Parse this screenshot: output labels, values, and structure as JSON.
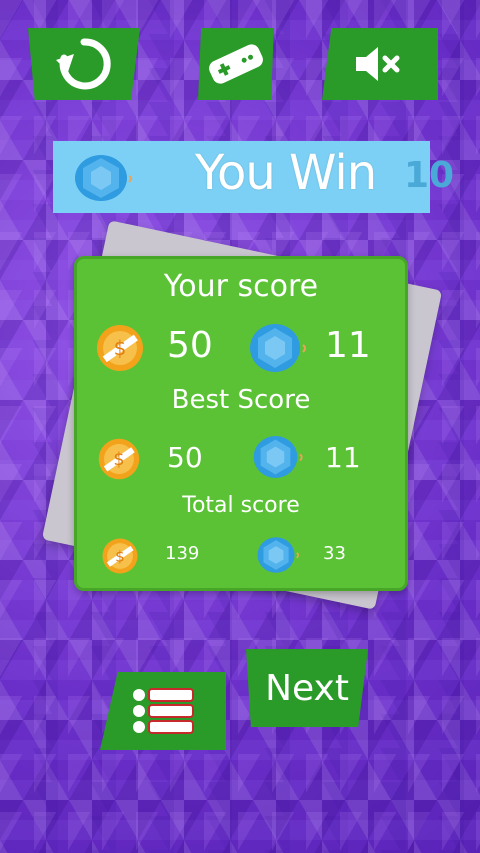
{
  "header": {
    "title": "You Win",
    "level": "10"
  },
  "toolbar": {
    "restart_icon": "restart-icon",
    "games_icon": "gamepad-icon",
    "mute_icon": "sound-muted-icon"
  },
  "scores": {
    "your_score_label": "Your score",
    "your_coins": "50",
    "your_gems": "11",
    "best_score_label": "Best Score",
    "best_coins": "50",
    "best_gems": "11",
    "total_score_label": "Total score",
    "total_coins": "139",
    "total_gems": "33"
  },
  "buttons": {
    "menu_icon": "menu-list-icon",
    "next_label": "Next"
  },
  "colors": {
    "background": "#7b3fd6",
    "button_green": "#2a9a28",
    "panel_green": "#5bc236",
    "banner_blue": "#7dd0f5",
    "gem_blue": "#2f9be0",
    "coin_orange": "#f2a31b"
  }
}
